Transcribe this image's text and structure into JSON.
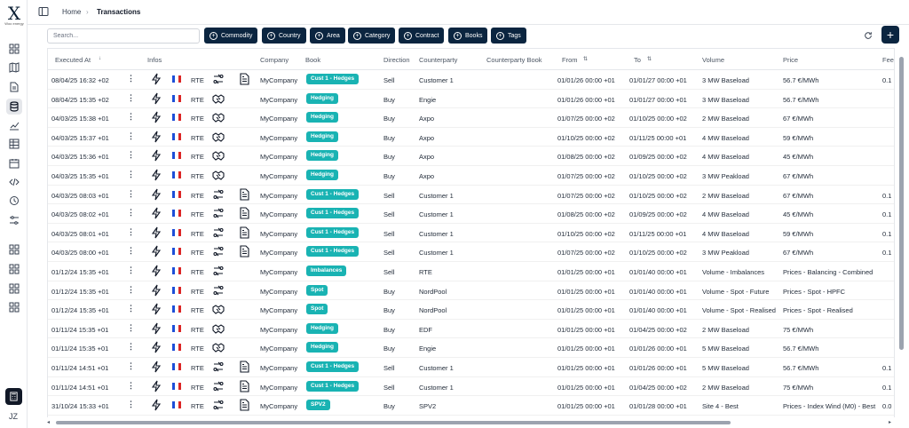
{
  "app": {
    "logo_letter": "X",
    "logo_sub": "Woo energy",
    "user_initials": "JZ"
  },
  "breadcrumb": {
    "home": "Home",
    "current": "Transactions"
  },
  "toolbar": {
    "search_placeholder": "Search...",
    "filters": [
      "Commodity",
      "Country",
      "Area",
      "Category",
      "Contract",
      "Books",
      "Tags"
    ]
  },
  "columns": [
    "Executed At",
    "Infos",
    "Company",
    "Book",
    "Direction",
    "Counterparty",
    "Counterparty Book",
    "From",
    "To",
    "Volume",
    "Price",
    "Fee"
  ],
  "colors": {
    "accent": "#0b2540",
    "badge": "#19b3b3",
    "flag_blue": "#1d4ed8",
    "flag_red": "#dc2626"
  },
  "rows": [
    {
      "executed": "08/04/25 16:32 +02",
      "source": "RTE",
      "doc": true,
      "hs": false,
      "company": "MyCompany",
      "book": "Cust 1 - Hedges",
      "direction": "Sell",
      "counterparty": "Customer 1",
      "cp_book": "",
      "from": "01/01/26 00:00 +01",
      "to": "01/01/27 00:00 +01",
      "volume": "3 MW Baseload",
      "price": "56.7 €/MWh",
      "fee": "0.1"
    },
    {
      "executed": "08/04/25 15:35 +02",
      "source": "RTE",
      "doc": false,
      "hs": true,
      "company": "MyCompany",
      "book": "Hedging",
      "direction": "Buy",
      "counterparty": "Engie",
      "cp_book": "",
      "from": "01/01/26 00:00 +01",
      "to": "01/01/27 00:00 +01",
      "volume": "3 MW Baseload",
      "price": "56.7 €/MWh",
      "fee": ""
    },
    {
      "executed": "04/03/25 15:38 +01",
      "source": "RTE",
      "doc": false,
      "hs": true,
      "company": "MyCompany",
      "book": "Hedging",
      "direction": "Buy",
      "counterparty": "Axpo",
      "cp_book": "",
      "from": "01/07/25 00:00 +02",
      "to": "01/10/25 00:00 +02",
      "volume": "2 MW Baseload",
      "price": "67 €/MWh",
      "fee": ""
    },
    {
      "executed": "04/03/25 15:37 +01",
      "source": "RTE",
      "doc": false,
      "hs": true,
      "company": "MyCompany",
      "book": "Hedging",
      "direction": "Buy",
      "counterparty": "Axpo",
      "cp_book": "",
      "from": "01/10/25 00:00 +02",
      "to": "01/11/25 00:00 +01",
      "volume": "4 MW Baseload",
      "price": "59 €/MWh",
      "fee": ""
    },
    {
      "executed": "04/03/25 15:36 +01",
      "source": "RTE",
      "doc": false,
      "hs": true,
      "company": "MyCompany",
      "book": "Hedging",
      "direction": "Buy",
      "counterparty": "Axpo",
      "cp_book": "",
      "from": "01/08/25 00:00 +02",
      "to": "01/09/25 00:00 +02",
      "volume": "4 MW Baseload",
      "price": "45 €/MWh",
      "fee": ""
    },
    {
      "executed": "04/03/25 15:35 +01",
      "source": "RTE",
      "doc": false,
      "hs": true,
      "company": "MyCompany",
      "book": "Hedging",
      "direction": "Buy",
      "counterparty": "Axpo",
      "cp_book": "",
      "from": "01/07/25 00:00 +02",
      "to": "01/10/25 00:00 +02",
      "volume": "3 MW Peakload",
      "price": "67 €/MWh",
      "fee": ""
    },
    {
      "executed": "04/03/25 08:03 +01",
      "source": "RTE",
      "doc": true,
      "hs": false,
      "company": "MyCompany",
      "book": "Cust 1 - Hedges",
      "direction": "Sell",
      "counterparty": "Customer 1",
      "cp_book": "",
      "from": "01/07/25 00:00 +02",
      "to": "01/10/25 00:00 +02",
      "volume": "2 MW Baseload",
      "price": "67 €/MWh",
      "fee": "0.1"
    },
    {
      "executed": "04/03/25 08:02 +01",
      "source": "RTE",
      "doc": true,
      "hs": false,
      "company": "MyCompany",
      "book": "Cust 1 - Hedges",
      "direction": "Sell",
      "counterparty": "Customer 1",
      "cp_book": "",
      "from": "01/08/25 00:00 +02",
      "to": "01/09/25 00:00 +02",
      "volume": "4 MW Baseload",
      "price": "45 €/MWh",
      "fee": "0.1"
    },
    {
      "executed": "04/03/25 08:01 +01",
      "source": "RTE",
      "doc": true,
      "hs": false,
      "company": "MyCompany",
      "book": "Cust 1 - Hedges",
      "direction": "Sell",
      "counterparty": "Customer 1",
      "cp_book": "",
      "from": "01/10/25 00:00 +02",
      "to": "01/11/25 00:00 +01",
      "volume": "4 MW Baseload",
      "price": "59 €/MWh",
      "fee": "0.1"
    },
    {
      "executed": "04/03/25 08:00 +01",
      "source": "RTE",
      "doc": true,
      "hs": false,
      "company": "MyCompany",
      "book": "Cust 1 - Hedges",
      "direction": "Sell",
      "counterparty": "Customer 1",
      "cp_book": "",
      "from": "01/07/25 00:00 +02",
      "to": "01/10/25 00:00 +02",
      "volume": "3 MW Peakload",
      "price": "67 €/MWh",
      "fee": "0.1"
    },
    {
      "executed": "01/12/24 15:35 +01",
      "source": "RTE",
      "doc": false,
      "hs": false,
      "company": "MyCompany",
      "book": "Imbalances",
      "direction": "Sell",
      "counterparty": "RTE",
      "cp_book": "",
      "from": "01/01/25 00:00 +01",
      "to": "01/01/40 00:00 +01",
      "volume": "Volume - Imbalances",
      "price": "Prices - Balancing - Combined",
      "fee": ""
    },
    {
      "executed": "01/12/24 15:35 +01",
      "source": "RTE",
      "doc": false,
      "hs": false,
      "company": "MyCompany",
      "book": "Spot",
      "direction": "Buy",
      "counterparty": "NordPool",
      "cp_book": "",
      "from": "01/01/25 00:00 +01",
      "to": "01/01/40 00:00 +01",
      "volume": "Volume - Spot - Future",
      "price": "Prices - Spot - HPFC",
      "fee": ""
    },
    {
      "executed": "01/12/24 15:35 +01",
      "source": "RTE",
      "doc": false,
      "hs": true,
      "company": "MyCompany",
      "book": "Spot",
      "direction": "Buy",
      "counterparty": "NordPool",
      "cp_book": "",
      "from": "01/01/25 00:00 +01",
      "to": "01/01/40 00:00 +01",
      "volume": "Volume - Spot - Realised",
      "price": "Prices - Spot - Realised",
      "fee": ""
    },
    {
      "executed": "01/11/24 15:35 +01",
      "source": "RTE",
      "doc": false,
      "hs": true,
      "company": "MyCompany",
      "book": "Hedging",
      "direction": "Buy",
      "counterparty": "EDF",
      "cp_book": "",
      "from": "01/01/25 00:00 +01",
      "to": "01/04/25 00:00 +02",
      "volume": "2 MW Baseload",
      "price": "75 €/MWh",
      "fee": ""
    },
    {
      "executed": "01/11/24 15:35 +01",
      "source": "RTE",
      "doc": false,
      "hs": true,
      "company": "MyCompany",
      "book": "Hedging",
      "direction": "Buy",
      "counterparty": "Engie",
      "cp_book": "",
      "from": "01/01/25 00:00 +01",
      "to": "01/01/26 00:00 +01",
      "volume": "5 MW Baseload",
      "price": "56.7 €/MWh",
      "fee": ""
    },
    {
      "executed": "01/11/24 14:51 +01",
      "source": "RTE",
      "doc": true,
      "hs": false,
      "company": "MyCompany",
      "book": "Cust 1 - Hedges",
      "direction": "Sell",
      "counterparty": "Customer 1",
      "cp_book": "",
      "from": "01/01/25 00:00 +01",
      "to": "01/01/26 00:00 +01",
      "volume": "5 MW Baseload",
      "price": "56.7 €/MWh",
      "fee": "0.1"
    },
    {
      "executed": "01/11/24 14:51 +01",
      "source": "RTE",
      "doc": true,
      "hs": false,
      "company": "MyCompany",
      "book": "Cust 1 - Hedges",
      "direction": "Sell",
      "counterparty": "Customer 1",
      "cp_book": "",
      "from": "01/01/25 00:00 +01",
      "to": "01/04/25 00:00 +02",
      "volume": "2 MW Baseload",
      "price": "75 €/MWh",
      "fee": "0.1"
    },
    {
      "executed": "31/10/24 15:33 +01",
      "source": "RTE",
      "doc": true,
      "hs": false,
      "company": "MyCompany",
      "book": "SPV2",
      "direction": "Buy",
      "counterparty": "SPV2",
      "cp_book": "",
      "from": "01/01/25 00:00 +01",
      "to": "01/01/28 00:00 +01",
      "volume": "Site 4 - Best",
      "price": "Prices - Index Wind (M0) - Best",
      "fee": "0.0"
    }
  ]
}
